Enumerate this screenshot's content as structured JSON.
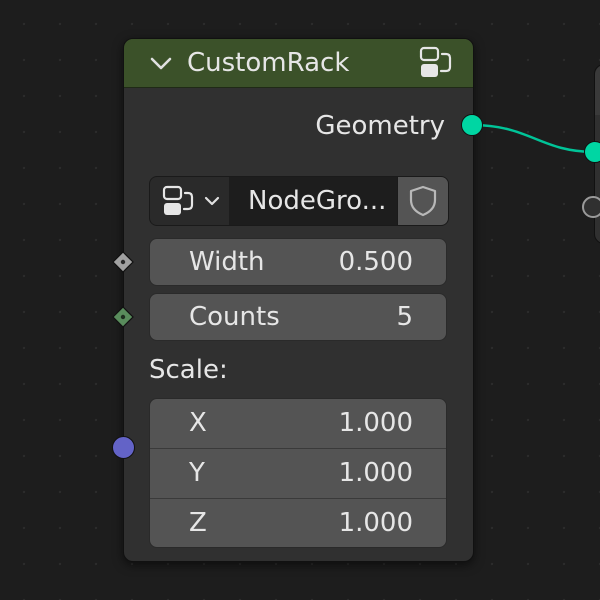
{
  "node": {
    "title": "CustomRack",
    "header_color": "#3b5129",
    "collapse_icon": "chevron-down-icon",
    "header_icon": "node-group-icon",
    "output": {
      "label": "Geometry",
      "socket_color": "#00d6a3"
    },
    "group_selector": {
      "type_icon": "node-group-icon",
      "name": "NodeGro...",
      "fake_user_icon": "shield-icon"
    },
    "fields": {
      "width": {
        "label": "Width",
        "value": "0.500"
      },
      "counts": {
        "label": "Counts",
        "value": "5"
      }
    },
    "scale": {
      "label": "Scale:",
      "socket_color": "#6363c7",
      "x": {
        "label": "X",
        "value": "1.000"
      },
      "y": {
        "label": "Y",
        "value": "1.000"
      },
      "z": {
        "label": "Z",
        "value": "1.000"
      }
    }
  },
  "colors": {
    "background": "#1d1d1d",
    "node_body": "#303030",
    "field": "#545454",
    "geometry_socket": "#00d6a3",
    "vector_socket": "#6363c7",
    "float_socket": "#a1a1a1",
    "int_socket": "#598c5c"
  }
}
